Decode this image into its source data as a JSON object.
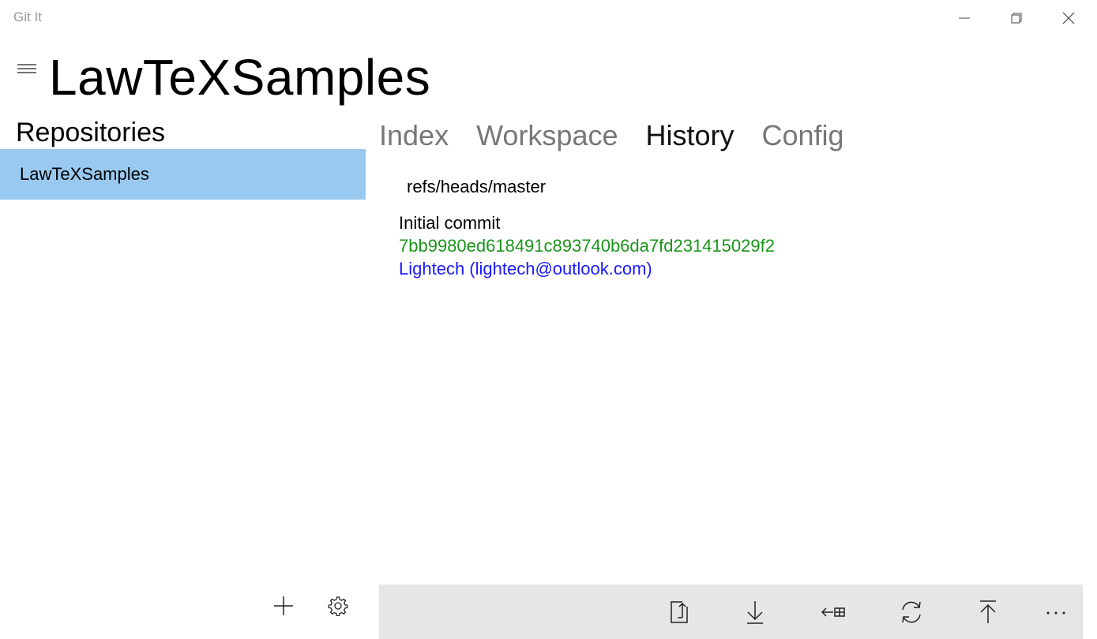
{
  "window": {
    "title": "Git It"
  },
  "header": {
    "repo_title": "LawTeXSamples"
  },
  "sidebar": {
    "heading": "Repositories",
    "items": [
      {
        "label": "LawTeXSamples",
        "selected": true
      }
    ]
  },
  "tabs": [
    {
      "label": "Index",
      "active": false
    },
    {
      "label": "Workspace",
      "active": false
    },
    {
      "label": "History",
      "active": true
    },
    {
      "label": "Config",
      "active": false
    }
  ],
  "history": {
    "branch": "refs/heads/master",
    "commits": [
      {
        "message": "Initial commit",
        "hash": "7bb9980ed618491c893740b6da7fd231415029f2",
        "author": "Lightech (lightech@outlook.com)"
      }
    ]
  },
  "icons": {
    "sidebar": [
      "add-icon",
      "settings-icon"
    ],
    "commandbar": [
      "checkout-icon",
      "pull-icon",
      "merge-icon",
      "sync-icon",
      "push-icon",
      "more-icon"
    ]
  },
  "colors": {
    "selected_item": "#99c9ef",
    "hash": "#1a961a",
    "author": "#1a1aff",
    "command_bar": "#e6e6e6"
  }
}
